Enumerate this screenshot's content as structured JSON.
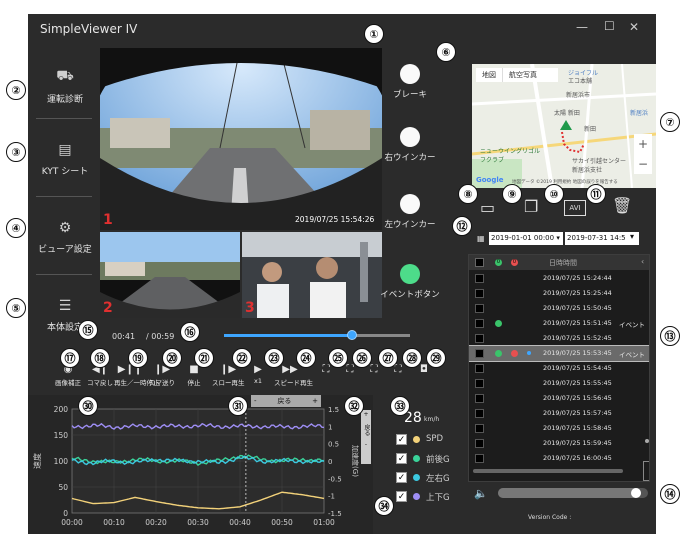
{
  "app": {
    "title": "SimpleViewer IV"
  },
  "window_controls": {
    "minimize": "—",
    "maximize": "☐",
    "close": "✕"
  },
  "sidebar": {
    "items": [
      {
        "label": "運転診断",
        "icon": "car-icon"
      },
      {
        "label": "KYT シート",
        "icon": "chart-icon"
      },
      {
        "label": "ビューア設定",
        "icon": "gear-icon"
      },
      {
        "label": "本体設定",
        "icon": "sliders-icon"
      }
    ]
  },
  "cameras": [
    {
      "number": "1",
      "timestamp": "2019/07/25 15:54:26"
    },
    {
      "number": "2"
    },
    {
      "number": "3"
    }
  ],
  "indicators": [
    {
      "label": "ブレーキ",
      "color": "#fafafa"
    },
    {
      "label": "右ウインカー",
      "color": "#fafafa"
    },
    {
      "label": "左ウインカー",
      "color": "#fafafa"
    },
    {
      "label": "イベントボタン",
      "color": "#4ddc8a"
    }
  ],
  "map": {
    "tab_map": "地図",
    "tab_satellite": "航空写真",
    "labels": [
      "ニューウイングリゴルフクラブ",
      "サカイ引越センター 新居浜支社",
      "新居浜市",
      "新田",
      "新居浜",
      "太陽 新田",
      "ジョイフル",
      "エコ本舗"
    ],
    "zoom_in": "+",
    "zoom_out": "−",
    "google": "Google",
    "footer": "地図データ ©2019  利用規約  地図の誤りを報告する"
  },
  "file_toolbar": {
    "avi_label": "AVI"
  },
  "date_range": {
    "start": "2019-01-01 00:00",
    "end": "2019-07-31 14:57"
  },
  "event_list": {
    "header_datetime": "日時時間",
    "header_dot1": "0",
    "header_dot2": "0",
    "rows": [
      {
        "time": "2019/07/25 15:24:44",
        "g": false,
        "r": false,
        "b": false,
        "note": ""
      },
      {
        "time": "2019/07/25 15:25:44",
        "g": false,
        "r": false,
        "b": false,
        "note": ""
      },
      {
        "time": "2019/07/25 15:50:45",
        "g": false,
        "r": false,
        "b": false,
        "note": ""
      },
      {
        "time": "2019/07/25 15:51:45",
        "g": true,
        "r": false,
        "b": false,
        "note": "イベント"
      },
      {
        "time": "2019/07/25 15:52:45",
        "g": false,
        "r": false,
        "b": false,
        "note": ""
      },
      {
        "time": "2019/07/25 15:53:45",
        "g": true,
        "r": true,
        "b": true,
        "note": "イベント"
      },
      {
        "time": "2019/07/25 15:54:45",
        "g": false,
        "r": false,
        "b": false,
        "note": ""
      },
      {
        "time": "2019/07/25 15:55:45",
        "g": false,
        "r": false,
        "b": false,
        "note": ""
      },
      {
        "time": "2019/07/25 15:56:45",
        "g": false,
        "r": false,
        "b": false,
        "note": ""
      },
      {
        "time": "2019/07/25 15:57:45",
        "g": false,
        "r": false,
        "b": false,
        "note": ""
      },
      {
        "time": "2019/07/25 15:58:45",
        "g": false,
        "r": false,
        "b": false,
        "note": ""
      },
      {
        "time": "2019/07/25 15:59:45",
        "g": false,
        "r": false,
        "b": false,
        "note": ""
      },
      {
        "time": "2019/07/25 16:00:45",
        "g": false,
        "r": false,
        "b": false,
        "note": ""
      }
    ],
    "selected_index": 5
  },
  "playback": {
    "current": "00:41",
    "total": "/ 00:59",
    "progress": 0.69
  },
  "controls": [
    {
      "label": "画像補正",
      "icon": "eye-icon",
      "glyph": "◉"
    },
    {
      "label": "コマ戻し",
      "icon": "frame-back-icon",
      "glyph": "◀❙"
    },
    {
      "label": "再生／一時停止",
      "icon": "play-pause-icon",
      "glyph": "▶❙❙"
    },
    {
      "label": "コマ送り",
      "icon": "frame-forward-icon",
      "glyph": "❙▶"
    },
    {
      "label": "停止",
      "icon": "stop-icon",
      "glyph": "■"
    },
    {
      "label": "スロー再生",
      "icon": "slow-play-icon",
      "glyph": "❙▶"
    },
    {
      "label": "x1",
      "icon": "play-icon",
      "glyph": "▶"
    },
    {
      "label": "スピード再生",
      "icon": "speed-play-icon",
      "glyph": "▶▶"
    },
    {
      "label": "",
      "icon": "fullscreen-icon",
      "glyph": "⛶"
    },
    {
      "label": "",
      "icon": "expand-icon",
      "glyph": "⛶"
    },
    {
      "label": "",
      "icon": "fit-icon",
      "glyph": "⛶"
    },
    {
      "label": "",
      "icon": "shrink-icon",
      "glyph": "⛶"
    },
    {
      "label": "",
      "icon": "camera-icon",
      "glyph": "◘"
    }
  ],
  "graph": {
    "back_label": "戻る",
    "back_minus": "-",
    "back_plus": "+",
    "side_label": "戻る",
    "side_plus": "+",
    "side_minus": "-",
    "ylabel_left": "速度",
    "ylabel_right": "加速度(G)",
    "left_ticks": [
      "200",
      "150",
      "100",
      "50",
      "0"
    ],
    "right_ticks": [
      "1.5",
      "1",
      "0.5",
      "0",
      "-0.5",
      "-1",
      "-1.5"
    ],
    "x_ticks": [
      "00:00",
      "00:10",
      "00:20",
      "00:30",
      "00:40",
      "00:50",
      "01:00"
    ],
    "speed_value": "28",
    "speed_unit": "km/h",
    "cursor_frac": 0.69
  },
  "chart_data": {
    "type": "line",
    "x": [
      0,
      5,
      10,
      15,
      20,
      25,
      30,
      35,
      40,
      45,
      50,
      55,
      60
    ],
    "xlabel": "",
    "ylabel": "速度",
    "ylim": [
      0,
      200
    ],
    "y2lim": [
      -1.5,
      1.5
    ],
    "series": [
      {
        "name": "SPD",
        "color": "#f3d27a",
        "axis": "left",
        "values": [
          28,
          18,
          20,
          30,
          22,
          15,
          10,
          8,
          12,
          25,
          40,
          35,
          28
        ]
      },
      {
        "name": "前後G",
        "color": "#3ad39a",
        "axis": "right",
        "values": [
          0.05,
          0.0,
          -0.05,
          0.05,
          0.0,
          0.0,
          -0.05,
          0.0,
          0.15,
          0.05,
          0.0,
          0.05,
          0.0
        ]
      },
      {
        "name": "左右G",
        "color": "#3cc9e0",
        "axis": "right",
        "values": [
          0.0,
          -0.05,
          0.0,
          -0.05,
          0.05,
          0.0,
          0.0,
          -0.05,
          0.1,
          0.0,
          0.0,
          0.0,
          -0.05
        ]
      },
      {
        "name": "上下G",
        "color": "#9e8ef5",
        "axis": "right",
        "values": [
          1.0,
          1.02,
          0.98,
          1.0,
          1.0,
          1.0,
          1.02,
          1.0,
          1.0,
          1.0,
          0.98,
          1.0,
          1.0
        ]
      }
    ]
  },
  "legend": [
    {
      "name": "SPD",
      "color": "#f3d27a",
      "checked": "✓"
    },
    {
      "name": "前後G",
      "color": "#3ad39a",
      "checked": "✓"
    },
    {
      "name": "左右G",
      "color": "#3cc9e0",
      "checked": "✓"
    },
    {
      "name": "上下G",
      "color": "#9e8ef5",
      "checked": "✓"
    }
  ],
  "volume": {
    "level": 0.95
  },
  "version": {
    "label": "Version Code :"
  },
  "callouts": [
    "①",
    "②",
    "③",
    "④",
    "⑤",
    "⑥",
    "⑦",
    "⑧",
    "⑨",
    "⑩",
    "⑪",
    "⑫",
    "⑬",
    "⑭",
    "⑮",
    "⑯",
    "⑰",
    "⑱",
    "⑲",
    "⑳",
    "㉑",
    "㉒",
    "㉓",
    "㉔",
    "㉕",
    "㉖",
    "㉗",
    "㉘",
    "㉙",
    "㉚",
    "㉛",
    "㉜",
    "㉝",
    "㉞"
  ]
}
